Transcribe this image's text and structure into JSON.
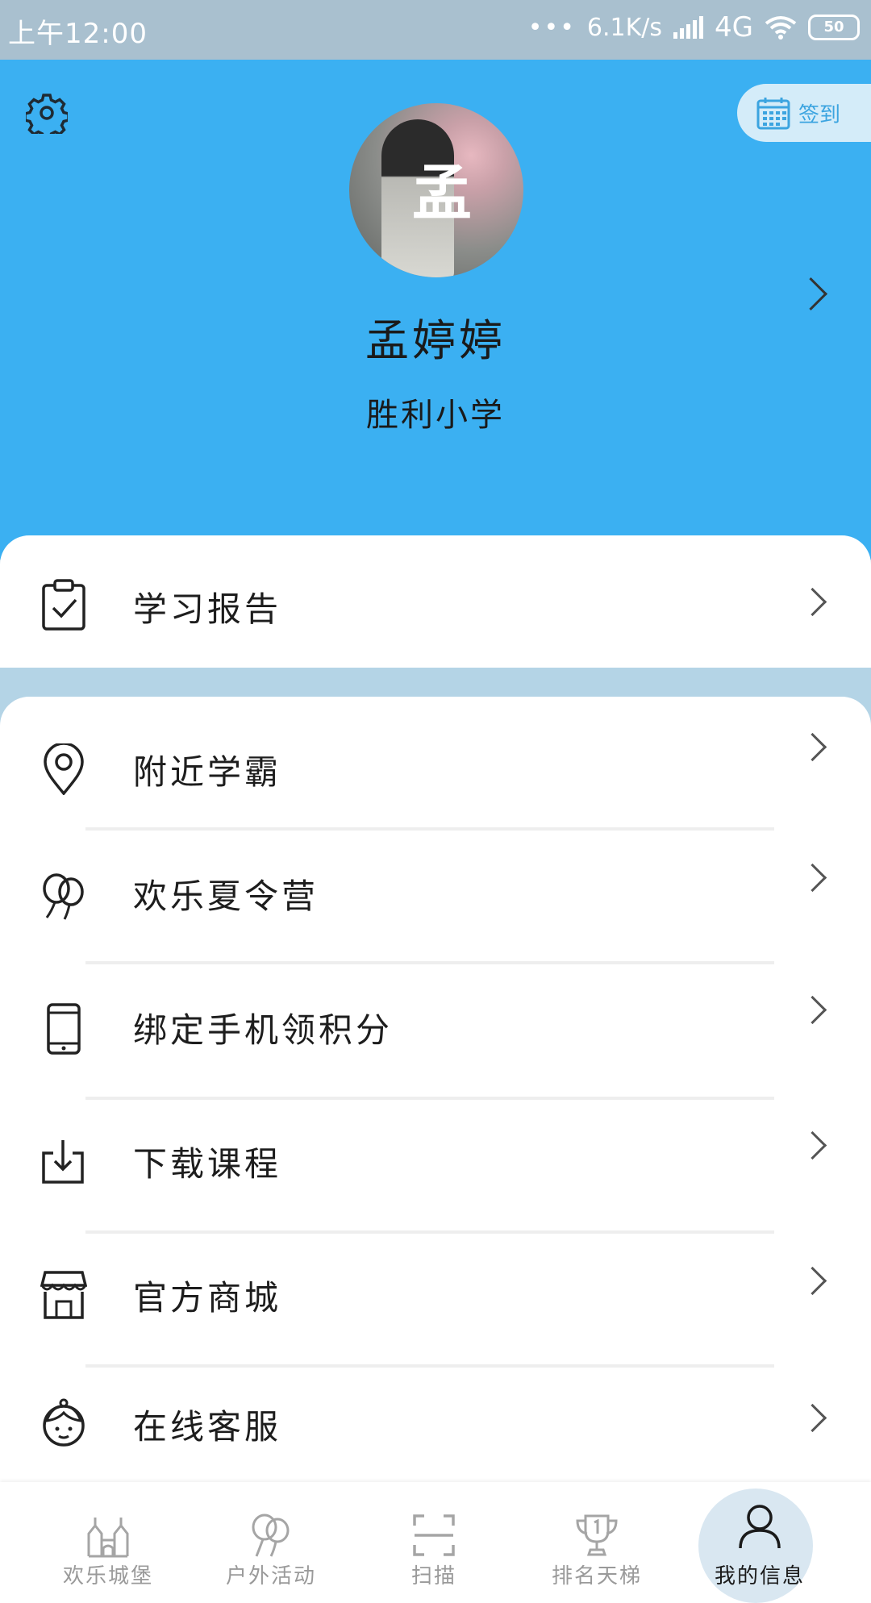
{
  "status_bar": {
    "time": "上午12:00",
    "dots": "•••",
    "net_speed": "6.1K/s",
    "network": "4G",
    "battery": "50"
  },
  "header": {
    "checkin_label": "签到",
    "avatar_seal": "孟",
    "user_name": "孟婷婷",
    "school": "胜利小学"
  },
  "menu_top": [
    {
      "label": "学习报告",
      "icon": "clipboard-check-icon"
    }
  ],
  "menu": [
    {
      "label": "附近学霸",
      "icon": "location-pin-icon"
    },
    {
      "label": "欢乐夏令营",
      "icon": "balloons-icon"
    },
    {
      "label": "绑定手机领积分",
      "icon": "phone-icon"
    },
    {
      "label": "下载课程",
      "icon": "download-icon"
    },
    {
      "label": "官方商城",
      "icon": "store-icon"
    },
    {
      "label": "在线客服",
      "icon": "customer-service-icon"
    }
  ],
  "bottom_nav": [
    {
      "label": "欢乐城堡",
      "icon": "castle-icon",
      "active": false
    },
    {
      "label": "户外活动",
      "icon": "balloons-icon",
      "active": false
    },
    {
      "label": "扫描",
      "icon": "scan-icon",
      "active": false
    },
    {
      "label": "排名天梯",
      "icon": "trophy-icon",
      "active": false
    },
    {
      "label": "我的信息",
      "icon": "user-icon",
      "active": true
    }
  ],
  "colors": {
    "header_bg": "#3bb0f2",
    "page_bg": "#b4d4e6",
    "accent": "#3ba4e0",
    "status_bar_bg": "#a9c0cf"
  }
}
